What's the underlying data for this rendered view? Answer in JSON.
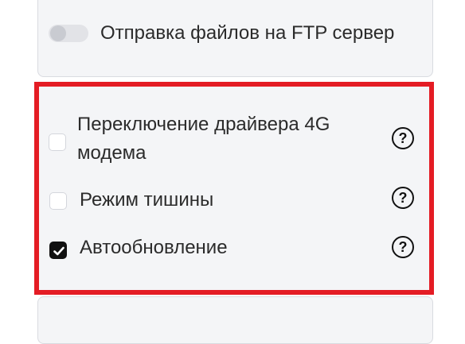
{
  "ftp": {
    "label": "Отправка файлов на FTP сервер",
    "enabled": false
  },
  "options": [
    {
      "label": "Переключение драйвера 4G модема",
      "checked": false,
      "help_icon": "question-circle-icon"
    },
    {
      "label": "Режим тишины",
      "checked": false,
      "help_icon": "question-circle-icon"
    },
    {
      "label": "Автообновление",
      "checked": true,
      "help_icon": "question-circle-icon"
    }
  ],
  "colors": {
    "highlight_border": "#e41c24",
    "card_background": "#f4f5f7",
    "checkbox_checked": "#111111"
  }
}
